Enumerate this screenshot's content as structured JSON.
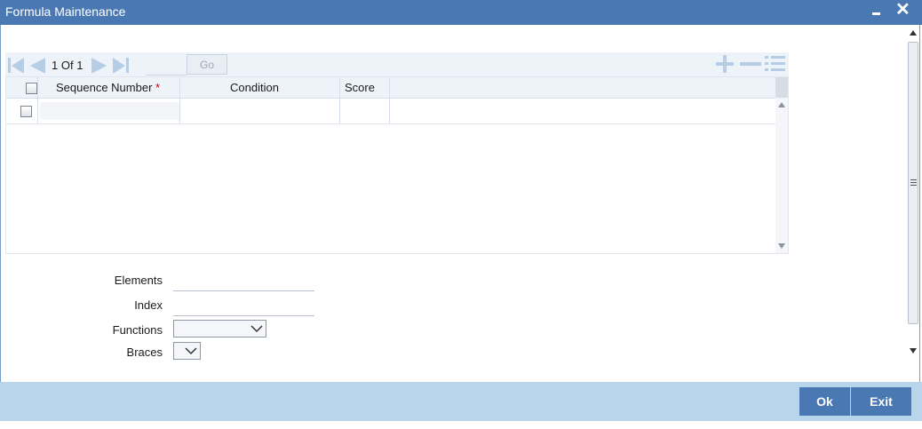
{
  "window": {
    "title": "Formula Maintenance"
  },
  "pager": {
    "current": "1",
    "of_label": "Of",
    "total": "1",
    "go_label": "Go",
    "page_input_value": ""
  },
  "grid": {
    "columns": [
      {
        "label": "Sequence Number",
        "required_mark": "*"
      },
      {
        "label": "Condition"
      },
      {
        "label": "Score"
      }
    ],
    "rows": [
      {
        "sequence_number": "",
        "condition": "",
        "score": ""
      }
    ]
  },
  "form": {
    "elements_label": "Elements",
    "elements_value": "",
    "index_label": "Index",
    "index_value": "",
    "functions_label": "Functions",
    "functions_value": "",
    "braces_label": "Braces",
    "braces_value": ""
  },
  "footer": {
    "ok_label": "Ok",
    "exit_label": "Exit"
  },
  "colors": {
    "titlebar": "#4a78b3",
    "footer": "#b9d5ec",
    "button": "#4a78b3",
    "nav_icon": "#b6cde6"
  }
}
